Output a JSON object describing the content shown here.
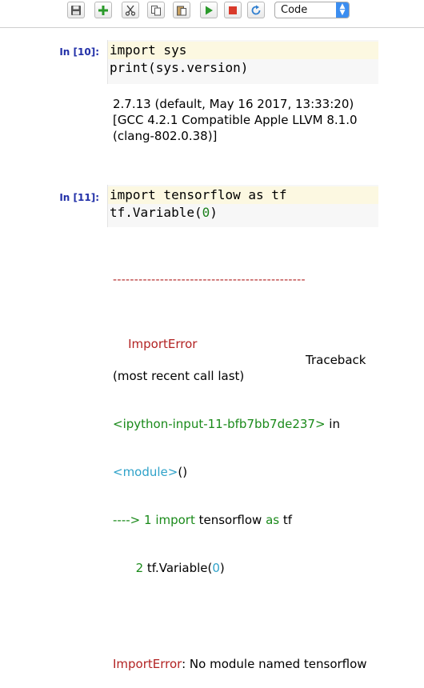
{
  "toolbar": {
    "buttons": [
      {
        "name": "save-button",
        "icon": "floppy-disk-icon"
      },
      {
        "name": "insert-cell-button",
        "icon": "plus-icon"
      },
      {
        "name": "cut-button",
        "icon": "scissors-icon"
      },
      {
        "name": "copy-button",
        "icon": "copy-icon"
      },
      {
        "name": "paste-button",
        "icon": "paste-icon"
      },
      {
        "name": "run-button",
        "icon": "play-icon"
      },
      {
        "name": "stop-button",
        "icon": "stop-icon"
      },
      {
        "name": "restart-button",
        "icon": "restart-icon"
      }
    ],
    "cell_type": "Code"
  },
  "cells": [
    {
      "prompt": "In [10]:",
      "code": [
        "import sys",
        "print(sys.version)"
      ],
      "output": [
        "2.7.13 (default, May 16 2017, 13:33:20)",
        "[GCC 4.2.1 Compatible Apple LLVM 8.1.0",
        "(clang-802.0.38)]"
      ]
    },
    {
      "prompt": "In [11]:",
      "code_line1": {
        "kw": "import",
        "rest": " tensorflow ",
        "kw2": "as",
        "rest2": " tf"
      },
      "code_line2": {
        "pre": "tf.Variable(",
        "num": "0",
        "post": ")"
      },
      "error": {
        "dashes": "---------------------------------------------",
        "name": "ImportError",
        "traceback": "Traceback",
        "recent": "(most recent call last)",
        "input_ref": "<ipython-input-11-bfb7bb7de237>",
        "in": " in",
        "module": "<module>",
        "module_paren": "()",
        "arrow": "----> 1 ",
        "arrow_kw": "import",
        "arrow_rest": " tensorflow ",
        "arrow_kw2": "as",
        "arrow_rest2": " tf",
        "line2_num": "      2 ",
        "line2_code": "tf.Variable(",
        "line2_arg": "0",
        "line2_close": ")",
        "final_name": "ImportError",
        "final_msg": ": No module named tensorflow"
      }
    }
  ],
  "colors": {
    "prompt": "#2230a8",
    "error": "#b22222",
    "green": "#1a8a1a",
    "cyan": "#2fa2c9",
    "accent": "#3b8df0"
  }
}
